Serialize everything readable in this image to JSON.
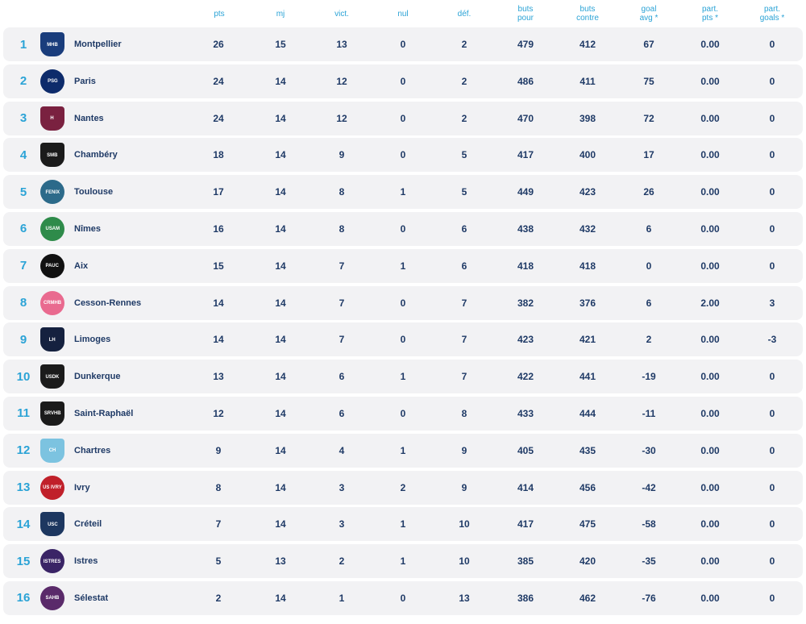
{
  "headers": {
    "pts": "pts",
    "mj": "mj",
    "vict": "vict.",
    "nul": "nul",
    "def": "déf.",
    "buts_pour": "buts\npour",
    "buts_contre": "buts\ncontre",
    "goal_avg": "goal\navg *",
    "part_pts": "part.\npts *",
    "part_goals": "part.\ngoals *"
  },
  "rows": [
    {
      "rank": "1",
      "team": "Montpellier",
      "logo_text": "MHB",
      "logo_color": "#1a3d7c",
      "pts": "26",
      "mj": "15",
      "vict": "13",
      "nul": "0",
      "def": "2",
      "bp": "479",
      "bc": "412",
      "ga": "67",
      "ppts": "0.00",
      "pgoals": "0"
    },
    {
      "rank": "2",
      "team": "Paris",
      "logo_text": "PSG",
      "logo_color": "#0d2b6b",
      "pts": "24",
      "mj": "14",
      "vict": "12",
      "nul": "0",
      "def": "2",
      "bp": "486",
      "bc": "411",
      "ga": "75",
      "ppts": "0.00",
      "pgoals": "0"
    },
    {
      "rank": "3",
      "team": "Nantes",
      "logo_text": "H",
      "logo_color": "#7a2140",
      "pts": "24",
      "mj": "14",
      "vict": "12",
      "nul": "0",
      "def": "2",
      "bp": "470",
      "bc": "398",
      "ga": "72",
      "ppts": "0.00",
      "pgoals": "0"
    },
    {
      "rank": "4",
      "team": "Chambéry",
      "logo_text": "SMB",
      "logo_color": "#1b1b1b",
      "pts": "18",
      "mj": "14",
      "vict": "9",
      "nul": "0",
      "def": "5",
      "bp": "417",
      "bc": "400",
      "ga": "17",
      "ppts": "0.00",
      "pgoals": "0"
    },
    {
      "rank": "5",
      "team": "Toulouse",
      "logo_text": "FENIX",
      "logo_color": "#2c6a8a",
      "pts": "17",
      "mj": "14",
      "vict": "8",
      "nul": "1",
      "def": "5",
      "bp": "449",
      "bc": "423",
      "ga": "26",
      "ppts": "0.00",
      "pgoals": "0"
    },
    {
      "rank": "6",
      "team": "Nîmes",
      "logo_text": "USAM",
      "logo_color": "#2e8b4a",
      "pts": "16",
      "mj": "14",
      "vict": "8",
      "nul": "0",
      "def": "6",
      "bp": "438",
      "bc": "432",
      "ga": "6",
      "ppts": "0.00",
      "pgoals": "0"
    },
    {
      "rank": "7",
      "team": "Aix",
      "logo_text": "PAUC",
      "logo_color": "#111111",
      "pts": "15",
      "mj": "14",
      "vict": "7",
      "nul": "1",
      "def": "6",
      "bp": "418",
      "bc": "418",
      "ga": "0",
      "ppts": "0.00",
      "pgoals": "0"
    },
    {
      "rank": "8",
      "team": "Cesson-Rennes",
      "logo_text": "CRMHB",
      "logo_color": "#e96a8f",
      "pts": "14",
      "mj": "14",
      "vict": "7",
      "nul": "0",
      "def": "7",
      "bp": "382",
      "bc": "376",
      "ga": "6",
      "ppts": "2.00",
      "pgoals": "3"
    },
    {
      "rank": "9",
      "team": "Limoges",
      "logo_text": "LH",
      "logo_color": "#15213f",
      "pts": "14",
      "mj": "14",
      "vict": "7",
      "nul": "0",
      "def": "7",
      "bp": "423",
      "bc": "421",
      "ga": "2",
      "ppts": "0.00",
      "pgoals": "-3"
    },
    {
      "rank": "10",
      "team": "Dunkerque",
      "logo_text": "USDK",
      "logo_color": "#1b1b1b",
      "pts": "13",
      "mj": "14",
      "vict": "6",
      "nul": "1",
      "def": "7",
      "bp": "422",
      "bc": "441",
      "ga": "-19",
      "ppts": "0.00",
      "pgoals": "0"
    },
    {
      "rank": "11",
      "team": "Saint-Raphaël",
      "logo_text": "SRVHB",
      "logo_color": "#1b1b1b",
      "pts": "12",
      "mj": "14",
      "vict": "6",
      "nul": "0",
      "def": "8",
      "bp": "433",
      "bc": "444",
      "ga": "-11",
      "ppts": "0.00",
      "pgoals": "0"
    },
    {
      "rank": "12",
      "team": "Chartres",
      "logo_text": "CH",
      "logo_color": "#7cc3e0",
      "pts": "9",
      "mj": "14",
      "vict": "4",
      "nul": "1",
      "def": "9",
      "bp": "405",
      "bc": "435",
      "ga": "-30",
      "ppts": "0.00",
      "pgoals": "0"
    },
    {
      "rank": "13",
      "team": "Ivry",
      "logo_text": "US IVRY",
      "logo_color": "#c0202a",
      "pts": "8",
      "mj": "14",
      "vict": "3",
      "nul": "2",
      "def": "9",
      "bp": "414",
      "bc": "456",
      "ga": "-42",
      "ppts": "0.00",
      "pgoals": "0"
    },
    {
      "rank": "14",
      "team": "Créteil",
      "logo_text": "USC",
      "logo_color": "#1d3760",
      "pts": "7",
      "mj": "14",
      "vict": "3",
      "nul": "1",
      "def": "10",
      "bp": "417",
      "bc": "475",
      "ga": "-58",
      "ppts": "0.00",
      "pgoals": "0"
    },
    {
      "rank": "15",
      "team": "Istres",
      "logo_text": "ISTRES",
      "logo_color": "#3a2466",
      "pts": "5",
      "mj": "13",
      "vict": "2",
      "nul": "1",
      "def": "10",
      "bp": "385",
      "bc": "420",
      "ga": "-35",
      "ppts": "0.00",
      "pgoals": "0"
    },
    {
      "rank": "16",
      "team": "Sélestat",
      "logo_text": "SAHB",
      "logo_color": "#5a2a6a",
      "pts": "2",
      "mj": "14",
      "vict": "1",
      "nul": "0",
      "def": "13",
      "bp": "386",
      "bc": "462",
      "ga": "-76",
      "ppts": "0.00",
      "pgoals": "0"
    }
  ]
}
